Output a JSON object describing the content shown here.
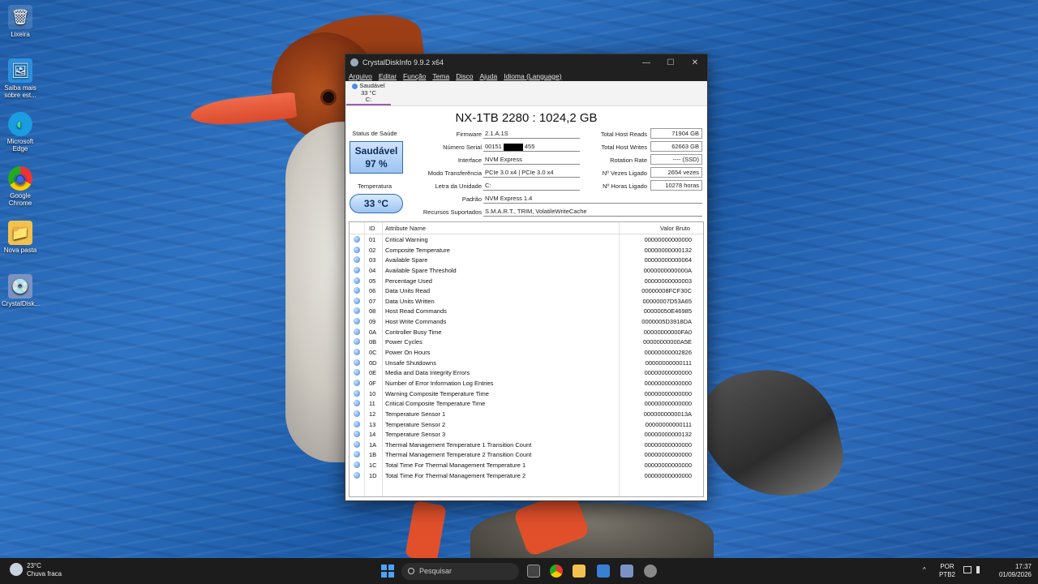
{
  "desktop": {
    "icons": [
      {
        "label": "Lixeira",
        "glyph": "🗑"
      },
      {
        "label": "Saiba mais sobre est...",
        "glyph": "🖼"
      },
      {
        "label": "Microsoft Edge",
        "glyph": "◐"
      },
      {
        "label": "Google Chrome",
        "glyph": "◉"
      },
      {
        "label": "Nova pasta",
        "glyph": "📁"
      },
      {
        "label": "CrystalDisk...",
        "glyph": "💿"
      }
    ]
  },
  "window": {
    "title": "CrystalDiskInfo 9.9.2 x64",
    "controls": {
      "minimize": "—",
      "maximize": "☐",
      "close": "✕"
    },
    "menu": [
      "Arquivo",
      "Editar",
      "Função",
      "Tema",
      "Disco",
      "Ajuda",
      "Idioma (Language)"
    ],
    "drive_tab": {
      "status": "Saudável",
      "temp": "33 °C",
      "letter": "C:"
    },
    "model": "NX-1TB 2280 : 1024,2 GB",
    "health": {
      "label": "Status de Saúde",
      "status": "Saudável",
      "percent": "97 %"
    },
    "temperature": {
      "label": "Temperatura",
      "value": "33 °C"
    },
    "info_left": {
      "firmware": {
        "label": "Firmware",
        "value": "2.1.A.1S"
      },
      "serial": {
        "label": "Número Serial",
        "value_prefix": "00151",
        "value_suffix": "455"
      },
      "interface": {
        "label": "Interface",
        "value": "NVM Express"
      },
      "transfer": {
        "label": "Modo Transferência",
        "value": "PCIe 3.0 x4 | PCIe 3.0 x4"
      },
      "drive_letter": {
        "label": "Letra da Unidade",
        "value": "C:"
      },
      "standard": {
        "label": "Padrão",
        "value": "NVM Express 1.4"
      },
      "features": {
        "label": "Recursos Suportados",
        "value": "S.M.A.R.T., TRIM, VolatileWriteCache"
      }
    },
    "info_right": {
      "host_reads": {
        "label": "Total Host Reads",
        "value": "71904 GB"
      },
      "host_writes": {
        "label": "Total Host Writes",
        "value": "62663 GB"
      },
      "rotation": {
        "label": "Rotation Rate",
        "value": "---- (SSD)"
      },
      "power_count": {
        "label": "Nº Vezes Ligado",
        "value": "2654 vezes"
      },
      "power_hours": {
        "label": "Nº Horas Ligado",
        "value": "10278 horas"
      }
    },
    "smart": {
      "headers": {
        "id": "ID",
        "name": "Attribute Name",
        "raw": "Valor Bruto"
      },
      "rows": [
        {
          "id": "01",
          "name": "Critical Warning",
          "raw": "00000000000000"
        },
        {
          "id": "02",
          "name": "Composite Temperature",
          "raw": "00000000000132"
        },
        {
          "id": "03",
          "name": "Available Spare",
          "raw": "00000000000064"
        },
        {
          "id": "04",
          "name": "Available Spare Threshold",
          "raw": "0000000000000A"
        },
        {
          "id": "05",
          "name": "Percentage Used",
          "raw": "00000000000003"
        },
        {
          "id": "06",
          "name": "Data Units Read",
          "raw": "00000008FCF30C"
        },
        {
          "id": "07",
          "name": "Data Units Written",
          "raw": "00000007D53A65"
        },
        {
          "id": "08",
          "name": "Host Read Commands",
          "raw": "00000050E46985"
        },
        {
          "id": "09",
          "name": "Host Write Commands",
          "raw": "0000005D3918DA"
        },
        {
          "id": "0A",
          "name": "Controller Busy Time",
          "raw": "00000000000FA0"
        },
        {
          "id": "0B",
          "name": "Power Cycles",
          "raw": "00000000000A5E"
        },
        {
          "id": "0C",
          "name": "Power On Hours",
          "raw": "00000000002826"
        },
        {
          "id": "0D",
          "name": "Unsafe Shutdowns",
          "raw": "00000000000111"
        },
        {
          "id": "0E",
          "name": "Media and Data Integrity Errors",
          "raw": "00000000000000"
        },
        {
          "id": "0F",
          "name": "Number of Error Information Log Entries",
          "raw": "00000000000000"
        },
        {
          "id": "10",
          "name": "Warning Composite Temperature Time",
          "raw": "00000000000000"
        },
        {
          "id": "11",
          "name": "Critical Composite Temperature Time",
          "raw": "00000000000000"
        },
        {
          "id": "12",
          "name": "Temperature Sensor 1",
          "raw": "0000000000013A"
        },
        {
          "id": "13",
          "name": "Temperature Sensor 2",
          "raw": "00000000000111"
        },
        {
          "id": "14",
          "name": "Temperature Sensor 3",
          "raw": "00000000000132"
        },
        {
          "id": "1A",
          "name": "Thermal Management Temperature 1 Transition Count",
          "raw": "00000000000000"
        },
        {
          "id": "1B",
          "name": "Thermal Management Temperature 2 Transition Count",
          "raw": "00000000000000"
        },
        {
          "id": "1C",
          "name": "Total Time For Thermal Management Temperature 1",
          "raw": "00000000000000"
        },
        {
          "id": "1D",
          "name": "Total Time For Thermal Management Temperature 2",
          "raw": "00000000000000"
        }
      ]
    }
  },
  "taskbar": {
    "weather": {
      "temp": "23°C",
      "desc": "Chuva fraca"
    },
    "search_placeholder": "Pesquisar",
    "language": {
      "line1": "POR",
      "line2": "PTB2"
    },
    "clock": {
      "time": "17:37",
      "date": "01/09/2026"
    },
    "tray_chevron": "^"
  },
  "colors": {
    "accent": "#4b8fe0",
    "health_text": "#0d2c5a",
    "titlebar": "#202020"
  }
}
